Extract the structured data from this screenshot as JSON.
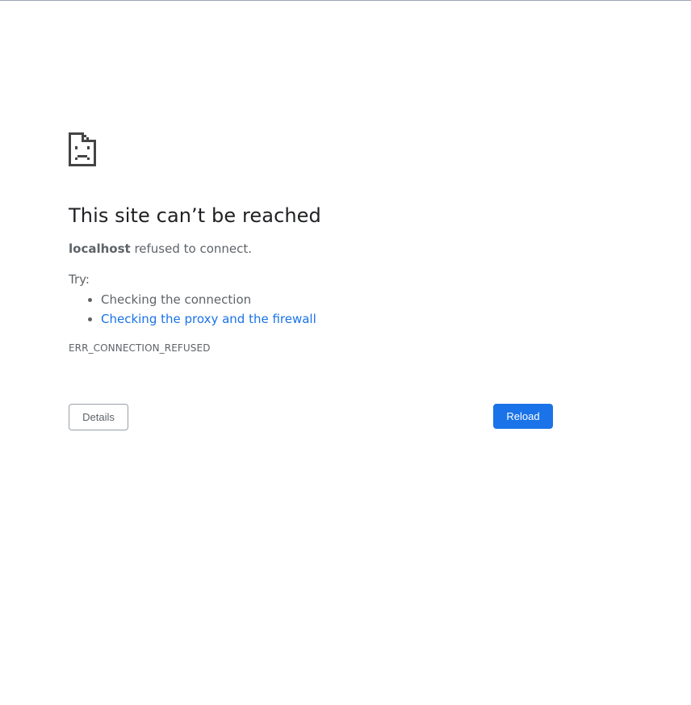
{
  "error": {
    "icon": "sad-page-icon",
    "title": "This site can’t be reached",
    "host": "localhost",
    "summary_suffix": " refused to connect.",
    "try_label": "Try:",
    "suggestions": [
      "Checking the connection",
      "Checking the proxy and the firewall"
    ],
    "code": "ERR_CONNECTION_REFUSED"
  },
  "buttons": {
    "details_label": "Details",
    "reload_label": "Reload"
  },
  "colors": {
    "link": "#1a73e8",
    "primary_button": "#1a73e8",
    "text_primary": "#202124",
    "text_secondary": "#5f6368"
  }
}
